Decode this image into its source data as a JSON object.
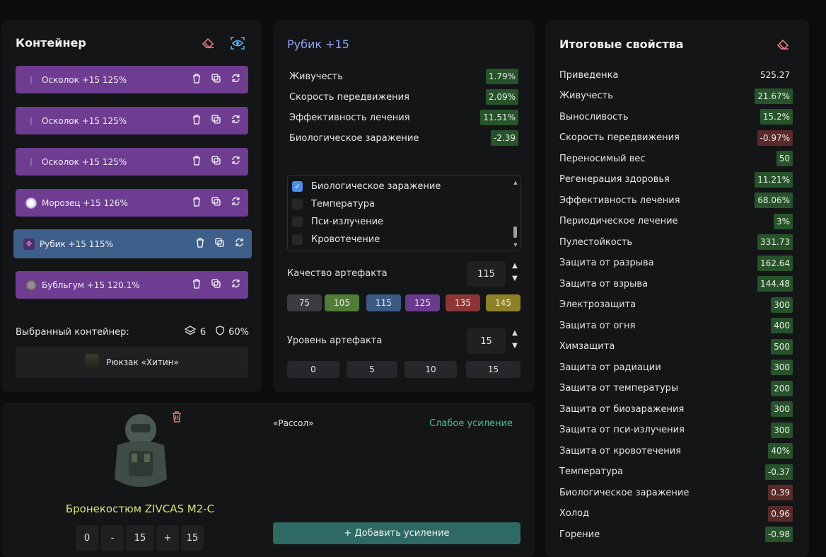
{
  "container": {
    "title": "Контейнер",
    "items": [
      {
        "label": "Осколок +15 125%",
        "icon": "shard-icon"
      },
      {
        "label": "Осколок +15 125%",
        "icon": "shard-icon"
      },
      {
        "label": "Осколок +15 125%",
        "icon": "shard-icon"
      },
      {
        "label": "Морозец +15 126%",
        "icon": "frost-orb-icon"
      },
      {
        "label": "Рубик +15 115%",
        "icon": "cube-icon",
        "selected": true
      },
      {
        "label": "Бубльгум +15 120.1%",
        "icon": "bubblegum-icon"
      }
    ],
    "selected_label": "Выбранный контейнер:",
    "slots": "6",
    "protection": "60%",
    "backpack": "Рюкзак «Хитин»"
  },
  "artifact": {
    "title": "Рубик +15",
    "stats": [
      {
        "name": "Живучесть",
        "value": "1.79%",
        "tone": "g"
      },
      {
        "name": "Скорость передвижения",
        "value": "2.09%",
        "tone": "g"
      },
      {
        "name": "Эффективность лечения",
        "value": "11.51%",
        "tone": "g"
      },
      {
        "name": "Биологическое заражение",
        "value": "-2.39",
        "tone": "g"
      }
    ],
    "options": [
      {
        "label": "Биологическое заражение",
        "checked": true
      },
      {
        "label": "Температура",
        "checked": false
      },
      {
        "label": "Пси-излучение",
        "checked": false
      },
      {
        "label": "Кровотечение",
        "checked": false
      }
    ],
    "quality_label": "Качество артефакта",
    "quality_value": "115",
    "quality_presets": [
      {
        "label": "75",
        "color": "#3b3c3f"
      },
      {
        "label": "105",
        "color": "#4f7d37"
      },
      {
        "label": "115",
        "color": "#3c5a86"
      },
      {
        "label": "125",
        "color": "#6a3a8c"
      },
      {
        "label": "135",
        "color": "#8c3535"
      },
      {
        "label": "145",
        "color": "#8d8128"
      }
    ],
    "level_label": "Уровень артефакта",
    "level_value": "15",
    "level_presets": [
      "0",
      "5",
      "10",
      "15"
    ]
  },
  "totals": {
    "title": "Итоговые свойства",
    "rows": [
      {
        "name": "Приведенка",
        "value": "525.27",
        "tone": "n"
      },
      {
        "name": "Живучесть",
        "value": "21.67%",
        "tone": "g"
      },
      {
        "name": "Выносливость",
        "value": "15.2%",
        "tone": "g"
      },
      {
        "name": "Скорость передвижения",
        "value": "-0.97%",
        "tone": "r"
      },
      {
        "name": "Переносимый вес",
        "value": "50",
        "tone": "g"
      },
      {
        "name": "Регенерация здоровья",
        "value": "11.21%",
        "tone": "g"
      },
      {
        "name": "Эффективность лечения",
        "value": "68.06%",
        "tone": "g"
      },
      {
        "name": "Периодическое лечение",
        "value": "3%",
        "tone": "g"
      },
      {
        "name": "Пулестойкость",
        "value": "331.73",
        "tone": "g"
      },
      {
        "name": "Защита от разрыва",
        "value": "162.64",
        "tone": "g"
      },
      {
        "name": "Защита от взрыва",
        "value": "144.48",
        "tone": "g"
      },
      {
        "name": "Электрозащита",
        "value": "300",
        "tone": "g"
      },
      {
        "name": "Защита от огня",
        "value": "400",
        "tone": "g"
      },
      {
        "name": "Химзащита",
        "value": "500",
        "tone": "g"
      },
      {
        "name": "Защита от радиации",
        "value": "300",
        "tone": "g"
      },
      {
        "name": "Защита от температуры",
        "value": "200",
        "tone": "g"
      },
      {
        "name": "Защита от биозаражения",
        "value": "300",
        "tone": "g"
      },
      {
        "name": "Защита от пси-излучения",
        "value": "300",
        "tone": "g"
      },
      {
        "name": "Защита от кровотечения",
        "value": "40%",
        "tone": "g"
      },
      {
        "name": "Температура",
        "value": "-0.37",
        "tone": "g"
      },
      {
        "name": "Биологическое заражение",
        "value": "0.39",
        "tone": "r"
      },
      {
        "name": "Холод",
        "value": "0.96",
        "tone": "r"
      },
      {
        "name": "Горение",
        "value": "-0.98",
        "tone": "g"
      }
    ]
  },
  "armor": {
    "name": "Бронекостюм ZIVCAS M2-C",
    "controls": [
      "0",
      "-",
      "15",
      "+",
      "15"
    ],
    "boost_name": "«Рассол»",
    "boost_level": "Слабое усиление",
    "add_button": "+ Добавить усиление"
  }
}
